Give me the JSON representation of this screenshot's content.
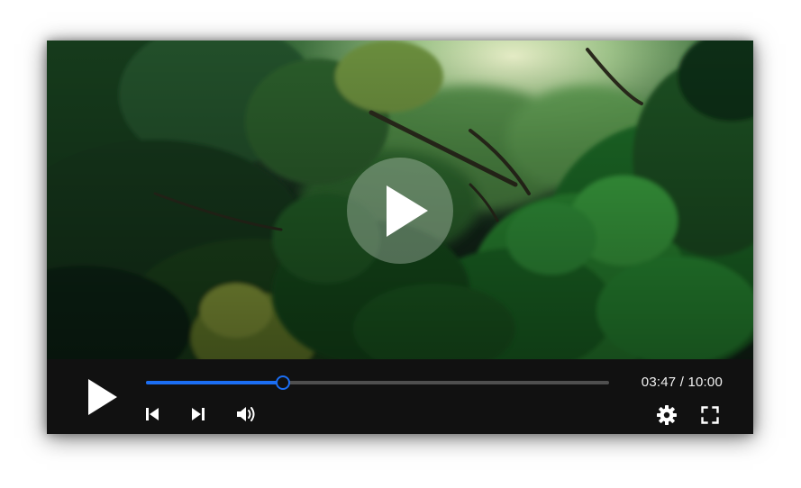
{
  "player": {
    "current_time": "03:47",
    "separator": " / ",
    "duration": "10:00",
    "progress_fraction": 0.295,
    "accent_color": "#1b6ef3"
  },
  "icons": {
    "big_play": "play-icon",
    "play": "play-icon",
    "previous": "skip-previous-icon",
    "next": "skip-next-icon",
    "volume": "volume-icon",
    "settings": "gear-icon",
    "fullscreen": "fullscreen-icon"
  }
}
